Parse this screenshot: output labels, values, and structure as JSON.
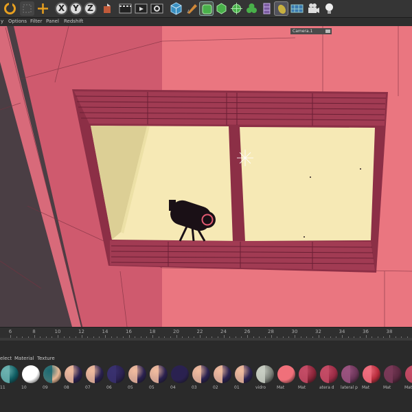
{
  "toolbar": {
    "buttons": [
      {
        "name": "undo-icon"
      },
      {
        "name": "live-selection-icon"
      },
      {
        "name": "move-icon"
      },
      {
        "name": "x-axis-icon",
        "label": "X"
      },
      {
        "name": "y-axis-icon",
        "label": "Y"
      },
      {
        "name": "z-axis-icon",
        "label": "Z"
      },
      {
        "name": "coordinate-system-icon"
      },
      {
        "name": "render-view-icon"
      },
      {
        "name": "render-picture-viewer-icon"
      },
      {
        "name": "render-settings-icon"
      },
      {
        "name": "cube-icon"
      },
      {
        "name": "pen-icon"
      },
      {
        "name": "subdivision-surface-icon"
      },
      {
        "name": "array-icon"
      },
      {
        "name": "bend-deformer-icon"
      },
      {
        "name": "cloner-icon"
      },
      {
        "name": "effector-icon"
      },
      {
        "name": "floor-icon"
      },
      {
        "name": "sky-icon"
      },
      {
        "name": "camera-icon"
      },
      {
        "name": "light-icon"
      }
    ]
  },
  "menubar": {
    "items": [
      "y",
      "Options",
      "Filter",
      "Panel",
      "Redshift"
    ]
  },
  "viewport": {
    "camera_label": "Camera.1",
    "colors": {
      "wall_dark": "#c85066",
      "wall_light": "#ea7680",
      "frame": "#8c2f46",
      "frame_light": "#a63d57",
      "window_glow": "#f6e9b5",
      "window_side": "#dccf95"
    }
  },
  "timeline": {
    "ticks": [
      "6",
      "8",
      "10",
      "12",
      "14",
      "16",
      "18",
      "20",
      "22",
      "24",
      "26",
      "28",
      "30",
      "32",
      "34",
      "36",
      "38"
    ]
  },
  "materials_panel": {
    "menu": [
      "elect",
      "Material",
      "Texture"
    ],
    "items": [
      {
        "label": "11",
        "color": "#0f5d63",
        "accent": "#6db3b0"
      },
      {
        "label": "10",
        "color": "#ffffff",
        "accent": "#ffffff"
      },
      {
        "label": "09",
        "color": "#e9b895",
        "accent": "#1d6a72"
      },
      {
        "label": "08",
        "color": "#2a2150",
        "accent": "#f2bda0"
      },
      {
        "label": "07",
        "color": "#2a2150",
        "accent": "#f2bda0"
      },
      {
        "label": "06",
        "color": "#2a2150",
        "accent": "#3a3170"
      },
      {
        "label": "05",
        "color": "#2a2150",
        "accent": "#f2bda0"
      },
      {
        "label": "05",
        "color": "#2a2150",
        "accent": "#f2bda0"
      },
      {
        "label": "04",
        "color": "#2a2150",
        "accent": "#2a2150"
      },
      {
        "label": "03",
        "color": "#2a2150",
        "accent": "#f2bda0"
      },
      {
        "label": "02",
        "color": "#2a2150",
        "accent": "#f2bda0"
      },
      {
        "label": "01",
        "color": "#2a2150",
        "accent": "#f2bda0"
      },
      {
        "label": "vidro",
        "color": "#7a7f78",
        "accent": "#c9cfc4"
      },
      {
        "label": "Mat",
        "color": "#f0707a",
        "accent": "#f0707a"
      },
      {
        "label": "Mat",
        "color": "#8a2438",
        "accent": "#c44c66"
      },
      {
        "label": "atera d",
        "color": "#9a2a44",
        "accent": "#c44c66"
      },
      {
        "label": "lateral p",
        "color": "#6a3458",
        "accent": "#9a5480"
      },
      {
        "label": "Mat",
        "color": "#b82c3c",
        "accent": "#f07080"
      },
      {
        "label": "Mat",
        "color": "#5a2840",
        "accent": "#7a3a58"
      },
      {
        "label": "Mat",
        "color": "#8a2438",
        "accent": "#c44c66"
      }
    ]
  }
}
